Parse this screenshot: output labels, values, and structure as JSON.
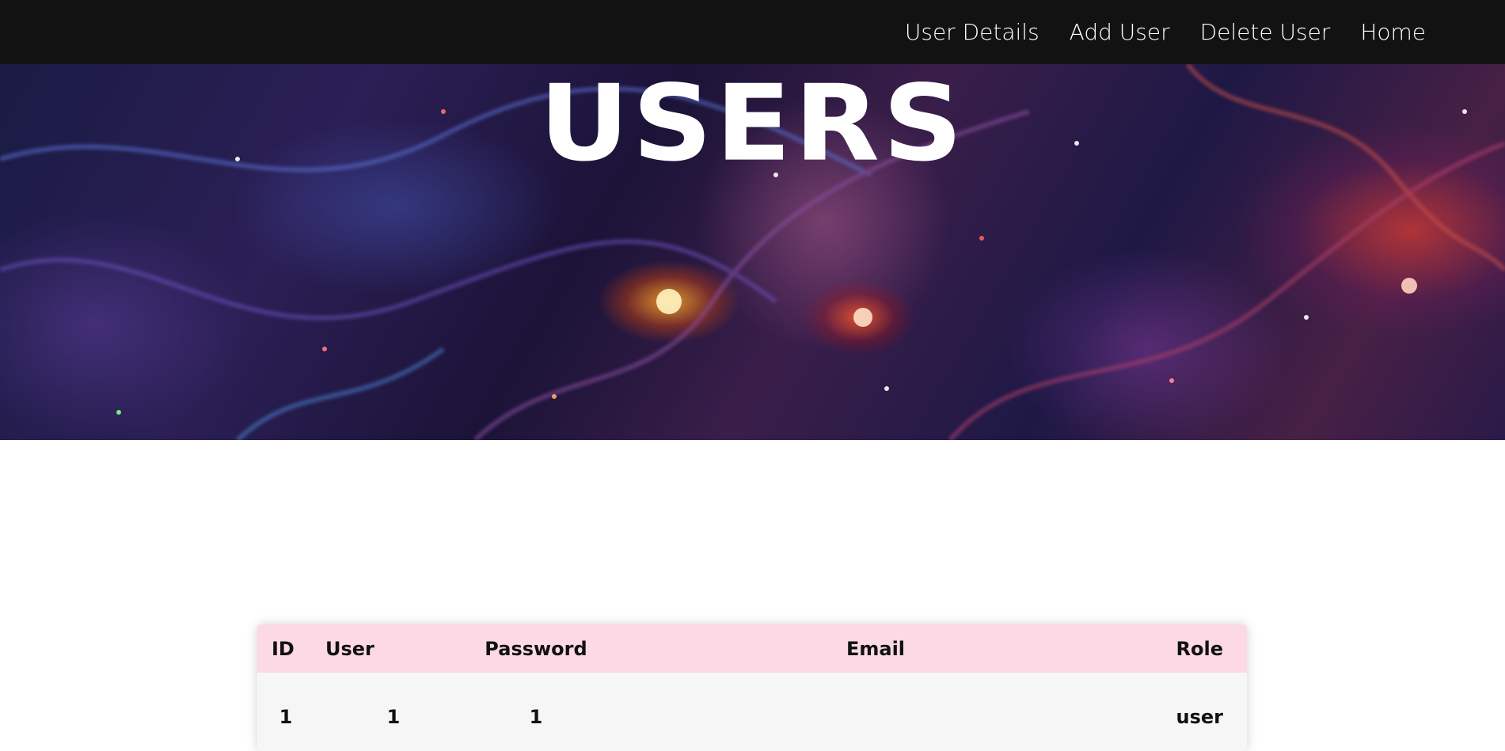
{
  "nav": {
    "links": [
      {
        "label": "User Details"
      },
      {
        "label": "Add User"
      },
      {
        "label": "Delete User"
      },
      {
        "label": "Home"
      }
    ]
  },
  "hero": {
    "title": "USERS"
  },
  "users_table": {
    "headers": {
      "id": "ID",
      "user": "User",
      "password": "Password",
      "email": "Email",
      "role": "Role"
    },
    "rows": [
      {
        "id": "1",
        "user": "1",
        "password": "1",
        "email": "",
        "role": "user"
      }
    ]
  },
  "colors": {
    "navbar_bg": "#121212",
    "table_header_bg": "#fcd9e4",
    "table_body_bg": "#f6f6f6"
  }
}
